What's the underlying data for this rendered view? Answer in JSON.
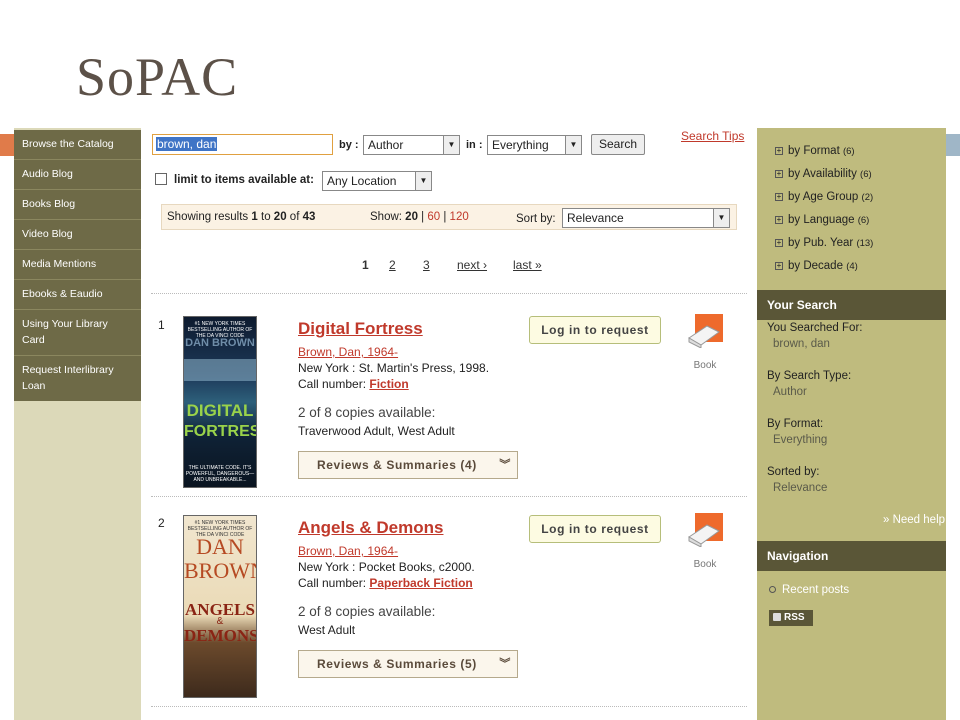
{
  "slide": {
    "title": "SoPAC"
  },
  "left_nav": {
    "items": [
      "Browse the Catalog",
      "Audio Blog",
      "Books Blog",
      "Video Blog",
      "Media Mentions",
      "Ebooks & Eaudio",
      "Using Your Library Card",
      "Request Interlibrary Loan"
    ]
  },
  "search": {
    "query": "brown, dan",
    "by_label": "by :",
    "by_value": "Author",
    "in_label": "in :",
    "in_value": "Everything",
    "search_button": "Search",
    "tips_link": "Search Tips",
    "limit_label": "limit to items available at:",
    "location_value": "Any Location"
  },
  "results_bar": {
    "showing_prefix": "Showing results",
    "range_start": "1",
    "to_word": "to",
    "range_end": "20",
    "of_word": "of",
    "total": "43",
    "show_label": "Show:",
    "show_current": "20",
    "show_60": "60",
    "show_120": "120",
    "sort_label": "Sort by:",
    "sort_value": "Relevance"
  },
  "pagination": {
    "p1": "1",
    "p2": "2",
    "p3": "3",
    "next": "next ›",
    "last": "last »"
  },
  "results": [
    {
      "num": "1",
      "title": "Digital Fortress",
      "author": "Brown, Dan, 1964-",
      "publisher": "New York : St. Martin's Press, 1998.",
      "call_label": "Call number:",
      "call_value": "Fiction",
      "copies": "2 of 8 copies available:",
      "locations": "Traverwood Adult, West Adult",
      "reviews": "Reviews & Summaries (4)",
      "request": "Log in to request",
      "format": "Book",
      "cover": {
        "banner": "#1 NEW YORK TIMES BESTSELLING AUTHOR OF THE DA VINCI CODE",
        "author": "DAN BROWN",
        "title1": "DIGITAL",
        "title2": "FORTRESS",
        "tagline": "THE ULTIMATE CODE. IT'S POWERFUL, DANGEROUS—AND UNBREAKABLE..."
      }
    },
    {
      "num": "2",
      "title": "Angels & Demons",
      "author": "Brown, Dan, 1964-",
      "publisher": "New York : Pocket Books, c2000.",
      "call_label": "Call number:",
      "call_value": "Paperback Fiction",
      "copies": "2 of 8 copies available:",
      "locations": "West Adult",
      "reviews": "Reviews & Summaries (5)",
      "request": "Log in to request",
      "format": "Book",
      "cover": {
        "banner": "#1 NEW YORK TIMES BESTSELLING AUTHOR OF THE DA VINCI CODE",
        "author1": "DAN",
        "author2": "BROWN",
        "title1": "ANGELS",
        "amp": "&",
        "title2": "DEMONS"
      }
    }
  ],
  "facets": [
    {
      "label": "by Format",
      "count": "(6)"
    },
    {
      "label": "by Availability",
      "count": "(6)"
    },
    {
      "label": "by Age Group",
      "count": "(2)"
    },
    {
      "label": "by Language",
      "count": "(6)"
    },
    {
      "label": "by Pub. Year",
      "count": "(13)"
    },
    {
      "label": "by Decade",
      "count": "(4)"
    }
  ],
  "your_search": {
    "heading": "Your Search",
    "searched_for_label": "You Searched For:",
    "searched_for_value": "brown, dan",
    "type_label": "By Search Type:",
    "type_value": "Author",
    "format_label": "By Format:",
    "format_value": "Everything",
    "sorted_label": "Sorted by:",
    "sorted_value": "Relevance",
    "help_link": "» Need help"
  },
  "navigation": {
    "heading": "Navigation",
    "recent_posts": "Recent posts",
    "rss": "RSS"
  },
  "colors": {
    "accent_link": "#c0392b",
    "left_nav_bg": "#6e6a47",
    "right_sidebar_bg": "#bfbb7e",
    "sidebar_header_bg": "#5a5637"
  }
}
